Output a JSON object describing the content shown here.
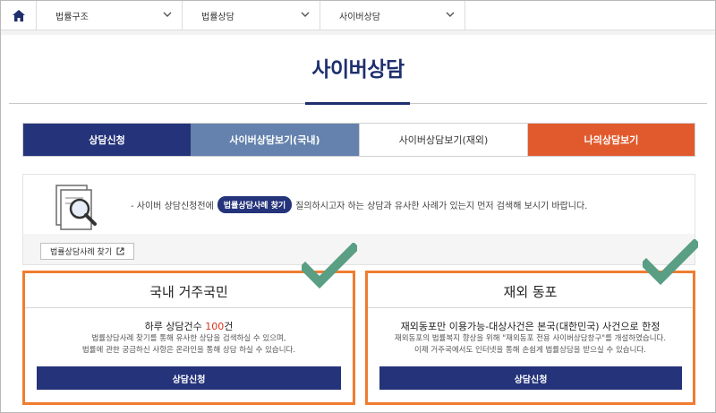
{
  "breadcrumb": {
    "home_icon": "home-icon",
    "level1": "법률구조",
    "level2": "법률상담",
    "level3": "사이버상담"
  },
  "page": {
    "title": "사이버상담"
  },
  "tabs": [
    {
      "label": "상담신청",
      "color": "#24337a"
    },
    {
      "label": "사이버상담보기(국내)",
      "color": "#6482ad"
    },
    {
      "label": "사이버상담보기(재외)",
      "color": "#ffffff"
    },
    {
      "label": "나의상담보기",
      "color": "#e15a2d"
    }
  ],
  "guide": {
    "icon": "document-search-icon",
    "text_before": "- 사이버 상담신청전에",
    "pill_label": "법률상담사례 찾기",
    "text_after": "질의하시고자 하는 상담과 유사한 사례가 있는지 먼저 검색해 보시기 바랍니다.",
    "search_link_label": "법률상담사례 찾기",
    "search_link_icon": "external-link-icon"
  },
  "cards": {
    "domestic": {
      "title": "국내 거주국민",
      "sub_prefix": "하루 상담건수 ",
      "sub_count": "100",
      "sub_suffix": "건",
      "desc_line1": "법률상담사례 찾기를 통해 유사한 상담을 검색하실 수 있으며,",
      "desc_line2": "법률에 관한 궁금하신 사항은 온라인을 통해 상담 하실 수 있습니다.",
      "button_label": "상담신청"
    },
    "overseas": {
      "title": "재외 동포",
      "sub": "재외동포만 이용가능-대상사건은 본국(대한민국) 사건으로 한정",
      "desc_line1": "재외동포의 법률복지 향상을 위해 \"재외동포 전용 사이버상담창구\"를 개설하였습니다.",
      "desc_line2": "이제 거주국에서도 인터넷을 통해 손쉽게 법률상담을 받으실 수 있습니다.",
      "button_label": "상담신청"
    }
  },
  "colors": {
    "navy": "#24337a",
    "highlight_border": "#ef7d2f",
    "checkmark": "#5a9e84"
  }
}
